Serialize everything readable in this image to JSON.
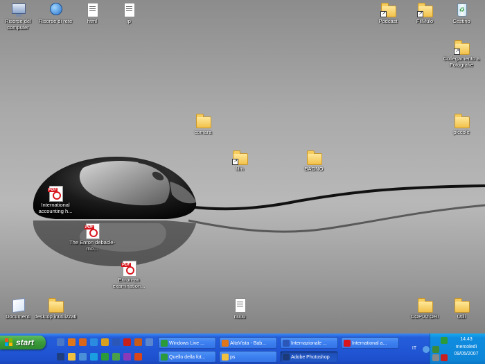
{
  "desktop": {
    "icons": [
      {
        "label": "Risorse del computer",
        "icon": "my-computer-icon"
      },
      {
        "label": "Risorse di rete",
        "icon": "network-places-icon"
      },
      {
        "label": "html",
        "icon": "text-file-icon"
      },
      {
        "label": "ip",
        "icon": "text-file-icon"
      },
      {
        "label": "Podcast",
        "icon": "folder-shortcut-icon"
      },
      {
        "label": "FilMulo",
        "icon": "folder-shortcut-icon"
      },
      {
        "label": "Cestino",
        "icon": "recycle-bin-icon"
      },
      {
        "label": "Collegamento a Fotografie",
        "icon": "folder-shortcut-icon"
      },
      {
        "label": "piccole",
        "icon": "folder-icon"
      },
      {
        "label": "comara",
        "icon": "folder-icon"
      },
      {
        "label": "film",
        "icon": "folder-shortcut-icon"
      },
      {
        "label": "BAGNO",
        "icon": "folder-icon"
      },
      {
        "label": "International accounting h...",
        "icon": "pdf-file-icon"
      },
      {
        "label": "The Enron debacle-mo...",
        "icon": "pdf-file-icon"
      },
      {
        "label": "Enron-an examination...",
        "icon": "pdf-file-icon"
      },
      {
        "label": "Documenti",
        "icon": "my-documents-icon"
      },
      {
        "label": "desktop inutilizzati",
        "icon": "folder-icon"
      },
      {
        "label": "nuuu",
        "icon": "text-file-icon"
      },
      {
        "label": "COPIATORI",
        "icon": "folder-icon"
      },
      {
        "label": "Utili",
        "icon": "folder-icon"
      }
    ]
  },
  "taskbar": {
    "start_label": "start",
    "quick_launch": [
      {
        "icon": "show-desktop-icon",
        "color": "#4a78c8"
      },
      {
        "icon": "firefox-icon",
        "color": "#e0761a"
      },
      {
        "icon": "firefox-icon",
        "color": "#d9661a"
      },
      {
        "icon": "internet-explorer-icon",
        "color": "#2a8be0"
      },
      {
        "icon": "shortcut-icon",
        "color": "#d8a020"
      },
      {
        "icon": "word-icon",
        "color": "#2b57b8"
      },
      {
        "icon": "opera-icon",
        "color": "#c8201a"
      },
      {
        "icon": "media-icon",
        "color": "#c85a1a"
      },
      {
        "icon": "window-icon",
        "color": "#5a86d0"
      },
      {
        "icon": "media-player-icon",
        "color": "#1e3e80"
      },
      {
        "icon": "folder-icon",
        "color": "#f0c040"
      },
      {
        "icon": "search-icon",
        "color": "#4a90d8"
      },
      {
        "icon": "skype-icon",
        "color": "#1aa0e0"
      },
      {
        "icon": "messenger-icon",
        "color": "#2a9a3a"
      },
      {
        "icon": "camera-icon",
        "color": "#4aa04a"
      },
      {
        "icon": "emule-icon",
        "color": "#8a3ab8"
      },
      {
        "icon": "office-icon",
        "color": "#d8461a"
      }
    ],
    "tasks": [
      {
        "label": "Windows Live ...",
        "icon": "messenger-icon",
        "color": "#2a9a3a"
      },
      {
        "label": "AltaVista - Bab...",
        "icon": "firefox-icon",
        "color": "#e0761a"
      },
      {
        "label": "Internazionale ...",
        "icon": "word-icon",
        "color": "#2b57b8"
      },
      {
        "label": "International a...",
        "icon": "pdf-icon",
        "color": "#d8151c"
      },
      {
        "label": "Quello della fot...",
        "icon": "messenger-icon",
        "color": "#2a9a3a"
      },
      {
        "label": "ps",
        "icon": "folder-icon",
        "color": "#f0c040"
      },
      {
        "label": "Adobe Photoshop",
        "icon": "photoshop-icon",
        "color": "#1a3a7a"
      }
    ],
    "language": "IT",
    "tray_icons": [
      {
        "icon": "expand-tray-icon",
        "color": "#5aa0e8"
      },
      {
        "icon": "network-tray-icon",
        "color": "#3a8a3a"
      },
      {
        "icon": "messenger-tray-icon",
        "color": "#2a9a3a"
      },
      {
        "icon": "volume-tray-icon",
        "color": "#888888"
      },
      {
        "icon": "security-tray-icon",
        "color": "#c82020"
      }
    ],
    "clock": {
      "time": "14.43",
      "day": "mercoledì",
      "date": "09/05/2007"
    }
  }
}
